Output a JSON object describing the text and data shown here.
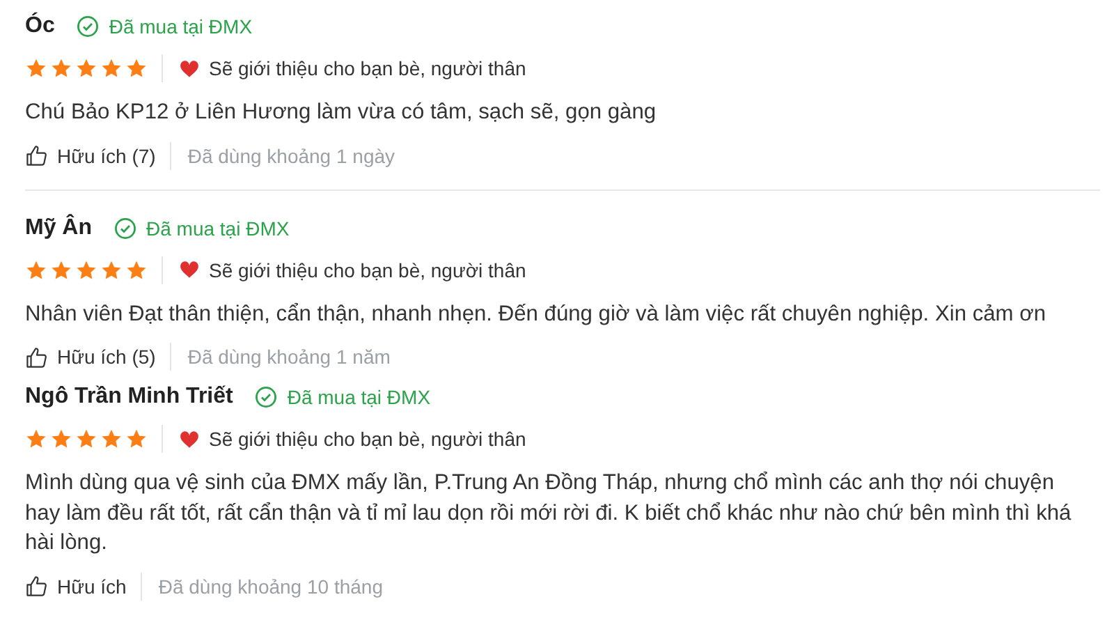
{
  "reviews": [
    {
      "name": "Óc",
      "badge": "Đã mua tại ĐMX",
      "stars": 5,
      "recommend": "Sẽ giới thiệu cho bạn bè, người thân",
      "comment": "Chú Bảo KP12 ở Liên Hương làm vừa có tâm, sạch sẽ, gọn gàng",
      "helpful": "Hữu ích (7)",
      "used": "Đã dùng khoảng 1 ngày",
      "divider": true
    },
    {
      "name": "Mỹ Ân",
      "badge": "Đã mua tại ĐMX",
      "stars": 5,
      "recommend": "Sẽ giới thiệu cho bạn bè, người thân",
      "comment": "Nhân viên Đạt thân thiện, cẩn thận, nhanh nhẹn. Đến đúng giờ và làm việc rất chuyên nghiệp. Xin cảm ơn",
      "helpful": "Hữu ích (5)",
      "used": "Đã dùng khoảng 1 năm",
      "divider": false
    },
    {
      "name": "Ngô Trần Minh Triết",
      "badge": "Đã mua tại ĐMX",
      "stars": 5,
      "recommend": "Sẽ giới thiệu cho bạn bè, người thân",
      "comment": "Mình dùng qua vệ sinh của ĐMX mấy lần, P.Trung An Đồng Tháp, nhưng chổ mình các anh thợ nói chuyện hay làm đều rất tốt, rất cẩn thận và tỉ mỉ lau dọn rồi mới rời đi. K biết chổ khác như nào chứ bên mình thì khá hài lòng.",
      "helpful": "Hữu ích",
      "used": "Đã dùng khoảng 10 tháng",
      "divider": false
    }
  ]
}
